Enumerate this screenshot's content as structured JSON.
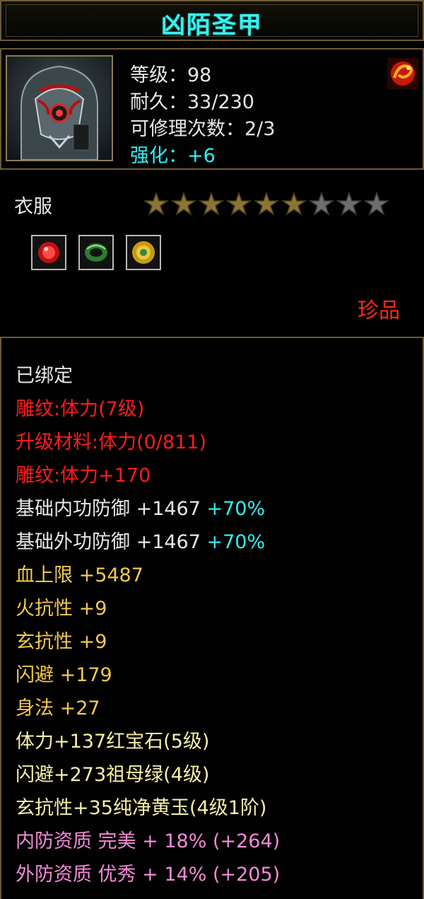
{
  "title": "凶陌圣甲",
  "header": {
    "level": "等级：98",
    "durability": "耐久：33/230",
    "repairs": "可修理次数：2/3",
    "enhance": "强化：+6"
  },
  "item_class": "衣服",
  "stars": {
    "total": 9,
    "filled": 6
  },
  "sockets": [
    {
      "name": "ruby",
      "color": "#d41a1a"
    },
    {
      "name": "emerald",
      "color": "#2f9a3a"
    },
    {
      "name": "yellow-jade",
      "color": "#d8b21e"
    }
  ],
  "rarity": "珍品",
  "stats": [
    {
      "text": "已绑定",
      "color": "white"
    },
    {
      "text": "雕纹:体力(7级)",
      "color": "red"
    },
    {
      "text": "升级材料:体力(0/811)",
      "color": "red"
    },
    {
      "text": "雕纹:体力+170",
      "color": "red"
    },
    {
      "text": "基础内功防御 +1467",
      "extra": "+70%",
      "color": "white"
    },
    {
      "text": "基础外功防御 +1467",
      "extra": "+70%",
      "color": "white"
    },
    {
      "text": "血上限 +5487",
      "color": "yellow"
    },
    {
      "text": "火抗性 +9",
      "color": "yellow"
    },
    {
      "text": "玄抗性 +9",
      "color": "yellow"
    },
    {
      "text": "闪避 +179",
      "color": "yellow"
    },
    {
      "text": "身法 +27",
      "color": "yellow"
    },
    {
      "text": "体力+137红宝石(5级)",
      "color": "lightyellow"
    },
    {
      "text": "闪避+273祖母绿(4级)",
      "color": "lightyellow"
    },
    {
      "text": "玄抗性+35纯净黄玉(4级1阶)",
      "color": "lightyellow"
    },
    {
      "text": "内防资质 完美 + 18% (+264)",
      "color": "pink"
    },
    {
      "text": "外防资质 优秀 + 14% (+205)",
      "color": "pink"
    }
  ]
}
